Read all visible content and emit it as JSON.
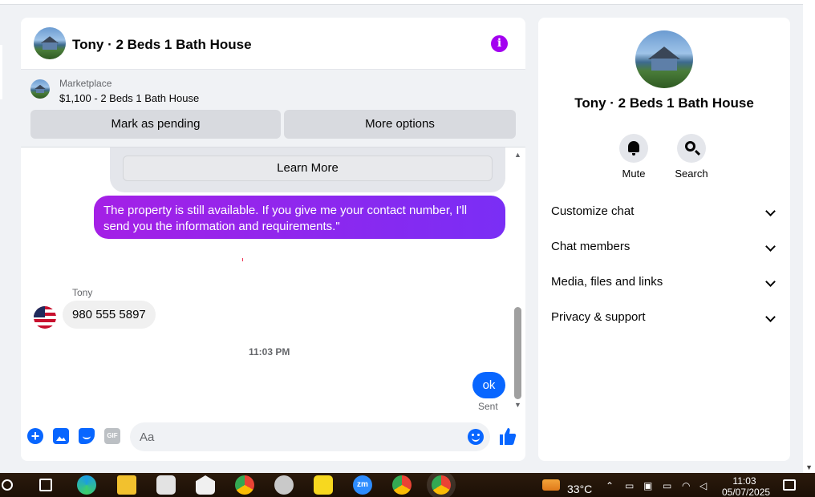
{
  "chat": {
    "title": "Tony · 2 Beds 1 Bath House",
    "info_icon": "info-icon",
    "listing": {
      "label": "Marketplace",
      "item": "$1,100 - 2 Beds 1 Bath House",
      "mark_pending": "Mark as pending",
      "more_options": "More options"
    },
    "learn_more": "Learn More",
    "messages": [
      {
        "direction": "outgoing",
        "text": "The property is still available. If you give me your contact number, I'll send you the information and requirements.\""
      },
      {
        "direction": "incoming",
        "sender": "Tony",
        "text": "980 555 5897"
      },
      {
        "type": "timestamp",
        "text": "11:03 PM"
      },
      {
        "direction": "outgoing",
        "text": "ok",
        "status": "Sent"
      }
    ],
    "composer": {
      "placeholder": "Aa",
      "gif_label": "GIF"
    }
  },
  "details": {
    "title": "Tony · 2 Beds 1 Bath House",
    "actions": {
      "mute": "Mute",
      "search": "Search"
    },
    "sections": [
      "Customize chat",
      "Chat members",
      "Media, files and links",
      "Privacy & support"
    ]
  },
  "taskbar": {
    "zoom_label": "zm",
    "temperature": "33°C",
    "time": "11:03",
    "date": "05/07/2025"
  },
  "colors": {
    "outgoing_gradient_start": "#a420e6",
    "outgoing_gradient_end": "#7a2ef5",
    "ok_bubble": "#0866ff",
    "info_icon": "#a300f0",
    "accent": "#0866ff"
  }
}
